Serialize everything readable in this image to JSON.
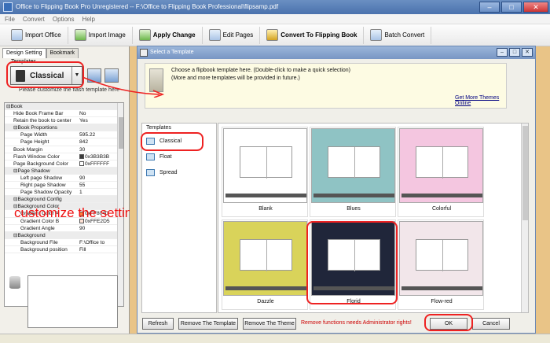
{
  "window": {
    "title": "Office to Flipping Book Pro Unregistered -- F:\\Office to Flipping Book Professional\\flipsamp.pdf"
  },
  "menu": [
    "File",
    "Convert",
    "Options",
    "Help"
  ],
  "toolbar": {
    "import_office": "Import Office",
    "import_image": "Import Image",
    "apply_change": "Apply Change",
    "edit_pages": "Edit Pages",
    "convert": "Convert To Flipping Book",
    "batch_convert": "Batch Convert"
  },
  "left_panel": {
    "tabs": [
      "Design Setting",
      "Bookmark"
    ],
    "templates_label": "Templates",
    "template_selected": "Classical",
    "hint": "Please customize the flash template here",
    "overlay_annotation": "customize the settings"
  },
  "properties": [
    {
      "key": "⊟Book",
      "value": "",
      "section": true,
      "indent": 0
    },
    {
      "key": "Hide Book Frame Bar",
      "value": "No",
      "indent": 1
    },
    {
      "key": "Retain the book to center",
      "value": "Yes",
      "indent": 1
    },
    {
      "key": "⊟Book Proportions",
      "value": "",
      "section": true,
      "indent": 1
    },
    {
      "key": "Page Width",
      "value": "595.22",
      "indent": 2
    },
    {
      "key": "Page Height",
      "value": "842",
      "indent": 2
    },
    {
      "key": "Book Margin",
      "value": "30",
      "indent": 1
    },
    {
      "key": "Flash Window Color",
      "value": "0x3B3B3B",
      "color": "#3b3b3b",
      "indent": 1
    },
    {
      "key": "Page Background Color",
      "value": "0xFFFFFF",
      "color": "#ffffff",
      "indent": 1
    },
    {
      "key": "⊟Page Shadow",
      "value": "",
      "section": true,
      "indent": 1
    },
    {
      "key": "Left page Shadow",
      "value": "90",
      "indent": 2
    },
    {
      "key": "Right page Shadow",
      "value": "55",
      "indent": 2
    },
    {
      "key": "Page Shadow Opacity",
      "value": "1",
      "indent": 2
    },
    {
      "key": "⊟Background Config",
      "value": "",
      "section": true,
      "indent": 1
    },
    {
      "key": "⊟Background Color",
      "value": "",
      "section": true,
      "indent": 1
    },
    {
      "key": "Gradient Color A",
      "value": "0xFF8040",
      "color": "#ff8040",
      "indent": 2
    },
    {
      "key": "Gradient Color B",
      "value": "0xFFE2D5",
      "color": "#ffe2d5",
      "indent": 2
    },
    {
      "key": "Gradient Angle",
      "value": "90",
      "indent": 2
    },
    {
      "key": "⊟Background",
      "value": "",
      "section": true,
      "indent": 1
    },
    {
      "key": "Background File",
      "value": "F:\\Office to",
      "indent": 2
    },
    {
      "key": "Background position",
      "value": "Fill",
      "indent": 2
    }
  ],
  "dialog": {
    "title": "Select a Template",
    "info_line1": "Choose a flipbook template here. (Double-click to make a quick selection)",
    "info_line2": "(More and more templates will be provided in future.)",
    "more_link": "Get More Themes Online",
    "templates_header": "Templates",
    "template_types": [
      "Classical",
      "Float",
      "Spread"
    ],
    "themes": [
      {
        "name": "Blank",
        "bg": "#ffffff"
      },
      {
        "name": "Blues",
        "bg": "#8fc3c4"
      },
      {
        "name": "Colorful",
        "bg": "#f4c6e0"
      },
      {
        "name": "Dazzle",
        "bg": "#d9d35a"
      },
      {
        "name": "Florid",
        "bg": "#20263a"
      },
      {
        "name": "Flow-red",
        "bg": "#f2e6ea"
      }
    ],
    "buttons": {
      "refresh": "Refresh",
      "remove_template": "Remove The Template",
      "remove_theme": "Remove The Theme",
      "ok": "OK",
      "cancel": "Cancel"
    },
    "warning": "Remove functions needs Administrator rights!"
  },
  "colors": {
    "annotation_red": "#e22222",
    "link_blue": "#000080"
  }
}
